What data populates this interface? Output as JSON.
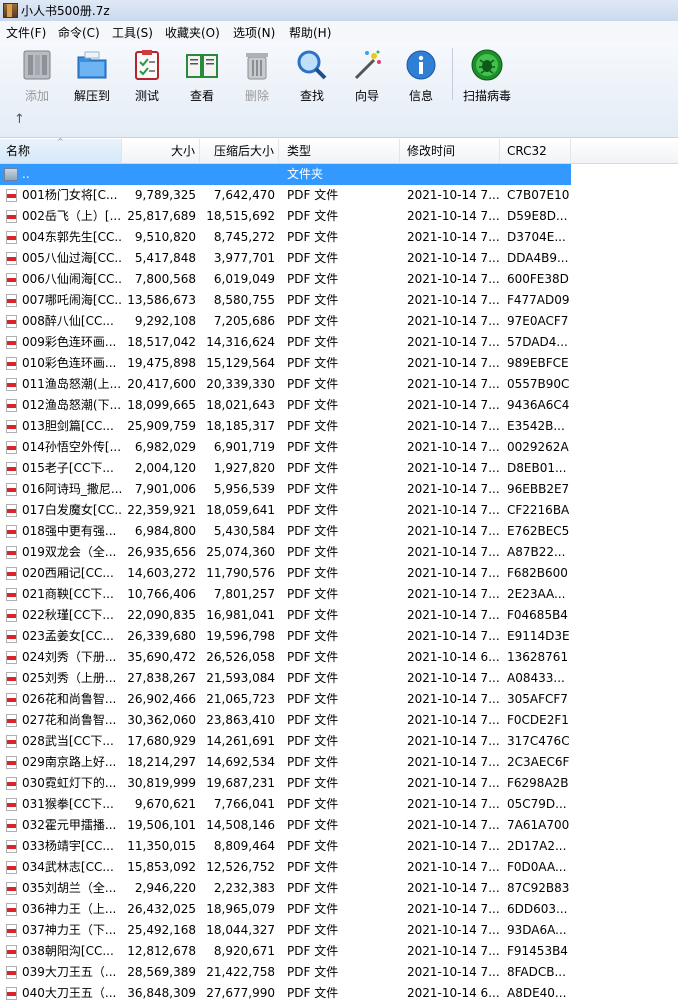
{
  "window": {
    "title": "小人书500册.7z"
  },
  "menu": [
    "文件(F)",
    "命令(C)",
    "工具(S)",
    "收藏夹(O)",
    "选项(N)",
    "帮助(H)"
  ],
  "toolbar": [
    {
      "label": "添加",
      "icon": "add-archive-icon",
      "disabled": true
    },
    {
      "label": "解压到",
      "icon": "extract-to-folder-icon",
      "disabled": false
    },
    {
      "label": "测试",
      "icon": "test-clipboard-icon",
      "disabled": false
    },
    {
      "label": "查看",
      "icon": "view-book-icon",
      "disabled": false
    },
    {
      "label": "删除",
      "icon": "delete-trash-icon",
      "disabled": true
    },
    {
      "label": "查找",
      "icon": "find-magnifier-icon",
      "disabled": false
    },
    {
      "label": "向导",
      "icon": "wizard-wand-icon",
      "disabled": false
    },
    {
      "label": "信息",
      "icon": "info-icon",
      "disabled": false
    },
    {
      "label": "扫描病毒",
      "icon": "scan-virus-icon",
      "disabled": false
    }
  ],
  "columns": [
    "名称",
    "大小",
    "压缩后大小",
    "类型",
    "修改时间",
    "CRC32"
  ],
  "parent_row": {
    "name": "..",
    "type": "文件夹"
  },
  "files": [
    {
      "name": "001杨门女将[C...",
      "size": "9,789,325",
      "packed": "7,642,470",
      "type": "PDF 文件",
      "mtime": "2021-10-14 7...",
      "crc": "C7B07E10"
    },
    {
      "name": "002岳飞（上）[...",
      "size": "25,817,689",
      "packed": "18,515,692",
      "type": "PDF 文件",
      "mtime": "2021-10-14 7...",
      "crc": "D59E8D..."
    },
    {
      "name": "004东郭先生[CC...",
      "size": "9,510,820",
      "packed": "8,745,272",
      "type": "PDF 文件",
      "mtime": "2021-10-14 7...",
      "crc": "D3704E..."
    },
    {
      "name": "005八仙过海[CC...",
      "size": "5,417,848",
      "packed": "3,977,701",
      "type": "PDF 文件",
      "mtime": "2021-10-14 7...",
      "crc": "DDA4B9..."
    },
    {
      "name": "006八仙闹海[CC...",
      "size": "7,800,568",
      "packed": "6,019,049",
      "type": "PDF 文件",
      "mtime": "2021-10-14 7...",
      "crc": "600FE38D"
    },
    {
      "name": "007哪吒闹海[CC...",
      "size": "13,586,673",
      "packed": "8,580,755",
      "type": "PDF 文件",
      "mtime": "2021-10-14 7...",
      "crc": "F477AD09"
    },
    {
      "name": "008醉八仙[CC...",
      "size": "9,292,108",
      "packed": "7,205,686",
      "type": "PDF 文件",
      "mtime": "2021-10-14 7...",
      "crc": "97E0ACF7"
    },
    {
      "name": "009彩色连环画...",
      "size": "18,517,042",
      "packed": "14,316,624",
      "type": "PDF 文件",
      "mtime": "2021-10-14 7...",
      "crc": "57DAD4..."
    },
    {
      "name": "010彩色连环画...",
      "size": "19,475,898",
      "packed": "15,129,564",
      "type": "PDF 文件",
      "mtime": "2021-10-14 7...",
      "crc": "989EBFCE"
    },
    {
      "name": "011渔岛怒潮(上...",
      "size": "20,417,600",
      "packed": "20,339,330",
      "type": "PDF 文件",
      "mtime": "2021-10-14 7...",
      "crc": "0557B90C"
    },
    {
      "name": "012渔岛怒潮(下...",
      "size": "18,099,665",
      "packed": "18,021,643",
      "type": "PDF 文件",
      "mtime": "2021-10-14 7...",
      "crc": "9436A6C4"
    },
    {
      "name": "013胆剑篇[CC...",
      "size": "25,909,759",
      "packed": "18,185,317",
      "type": "PDF 文件",
      "mtime": "2021-10-14 7...",
      "crc": "E3542B..."
    },
    {
      "name": "014孙悟空外传[...",
      "size": "6,982,029",
      "packed": "6,901,719",
      "type": "PDF 文件",
      "mtime": "2021-10-14 7...",
      "crc": "0029262A"
    },
    {
      "name": "015老子[CC下...",
      "size": "2,004,120",
      "packed": "1,927,820",
      "type": "PDF 文件",
      "mtime": "2021-10-14 7...",
      "crc": "D8EB01..."
    },
    {
      "name": "016阿诗玛_撒尼...",
      "size": "7,901,006",
      "packed": "5,956,539",
      "type": "PDF 文件",
      "mtime": "2021-10-14 7...",
      "crc": "96EBB2E7"
    },
    {
      "name": "017白发魔女[CC...",
      "size": "22,359,921",
      "packed": "18,059,641",
      "type": "PDF 文件",
      "mtime": "2021-10-14 7...",
      "crc": "CF2216BA"
    },
    {
      "name": "018强中更有强...",
      "size": "6,984,800",
      "packed": "5,430,584",
      "type": "PDF 文件",
      "mtime": "2021-10-14 7...",
      "crc": "E762BEC5"
    },
    {
      "name": "019双龙会（全...",
      "size": "26,935,656",
      "packed": "25,074,360",
      "type": "PDF 文件",
      "mtime": "2021-10-14 7...",
      "crc": "A87B22..."
    },
    {
      "name": "020西厢记[CC...",
      "size": "14,603,272",
      "packed": "11,790,576",
      "type": "PDF 文件",
      "mtime": "2021-10-14 7...",
      "crc": "F682B600"
    },
    {
      "name": "021商鞅[CC下...",
      "size": "10,766,406",
      "packed": "7,801,257",
      "type": "PDF 文件",
      "mtime": "2021-10-14 7...",
      "crc": "2E23AA..."
    },
    {
      "name": "022秋瑾[CC下...",
      "size": "22,090,835",
      "packed": "16,981,041",
      "type": "PDF 文件",
      "mtime": "2021-10-14 7...",
      "crc": "F04685B4"
    },
    {
      "name": "023孟姜女[CC...",
      "size": "26,339,680",
      "packed": "19,596,798",
      "type": "PDF 文件",
      "mtime": "2021-10-14 7...",
      "crc": "E9114D3E"
    },
    {
      "name": "024刘秀（下册...",
      "size": "35,690,472",
      "packed": "26,526,058",
      "type": "PDF 文件",
      "mtime": "2021-10-14 6...",
      "crc": "13628761"
    },
    {
      "name": "025刘秀（上册...",
      "size": "27,838,267",
      "packed": "21,593,084",
      "type": "PDF 文件",
      "mtime": "2021-10-14 7...",
      "crc": "A08433..."
    },
    {
      "name": "026花和尚鲁智...",
      "size": "26,902,466",
      "packed": "21,065,723",
      "type": "PDF 文件",
      "mtime": "2021-10-14 7...",
      "crc": "305AFCF7"
    },
    {
      "name": "027花和尚鲁智...",
      "size": "30,362,060",
      "packed": "23,863,410",
      "type": "PDF 文件",
      "mtime": "2021-10-14 7...",
      "crc": "F0CDE2F1"
    },
    {
      "name": "028武当[CC下...",
      "size": "17,680,929",
      "packed": "14,261,691",
      "type": "PDF 文件",
      "mtime": "2021-10-14 7...",
      "crc": "317C476C"
    },
    {
      "name": "029南京路上好...",
      "size": "18,214,297",
      "packed": "14,692,534",
      "type": "PDF 文件",
      "mtime": "2021-10-14 7...",
      "crc": "2C3AEC6F"
    },
    {
      "name": "030霓虹灯下的...",
      "size": "30,819,999",
      "packed": "19,687,231",
      "type": "PDF 文件",
      "mtime": "2021-10-14 7...",
      "crc": "F6298A2B"
    },
    {
      "name": "031猴拳[CC下...",
      "size": "9,670,621",
      "packed": "7,766,041",
      "type": "PDF 文件",
      "mtime": "2021-10-14 7...",
      "crc": "05C79D..."
    },
    {
      "name": "032霍元甲擂播...",
      "size": "19,506,101",
      "packed": "14,508,146",
      "type": "PDF 文件",
      "mtime": "2021-10-14 7...",
      "crc": "7A61A700"
    },
    {
      "name": "033杨靖宇[CC...",
      "size": "11,350,015",
      "packed": "8,809,464",
      "type": "PDF 文件",
      "mtime": "2021-10-14 7...",
      "crc": "2D17A2..."
    },
    {
      "name": "034武林志[CC...",
      "size": "15,853,092",
      "packed": "12,526,752",
      "type": "PDF 文件",
      "mtime": "2021-10-14 7...",
      "crc": "F0D0AA..."
    },
    {
      "name": "035刘胡兰（全...",
      "size": "2,946,220",
      "packed": "2,232,383",
      "type": "PDF 文件",
      "mtime": "2021-10-14 7...",
      "crc": "87C92B83"
    },
    {
      "name": "036神力王（上...",
      "size": "26,432,025",
      "packed": "18,965,079",
      "type": "PDF 文件",
      "mtime": "2021-10-14 7...",
      "crc": "6DD603..."
    },
    {
      "name": "037神力王（下...",
      "size": "25,492,168",
      "packed": "18,044,327",
      "type": "PDF 文件",
      "mtime": "2021-10-14 7...",
      "crc": "93DA6A..."
    },
    {
      "name": "038朝阳沟[CC...",
      "size": "12,812,678",
      "packed": "8,920,671",
      "type": "PDF 文件",
      "mtime": "2021-10-14 7...",
      "crc": "F91453B4"
    },
    {
      "name": "039大刀王五（...",
      "size": "28,569,389",
      "packed": "21,422,758",
      "type": "PDF 文件",
      "mtime": "2021-10-14 7...",
      "crc": "8FADCB..."
    },
    {
      "name": "040大刀王五（...",
      "size": "36,848,309",
      "packed": "27,677,990",
      "type": "PDF 文件",
      "mtime": "2021-10-14 6...",
      "crc": "A8DE40..."
    }
  ]
}
